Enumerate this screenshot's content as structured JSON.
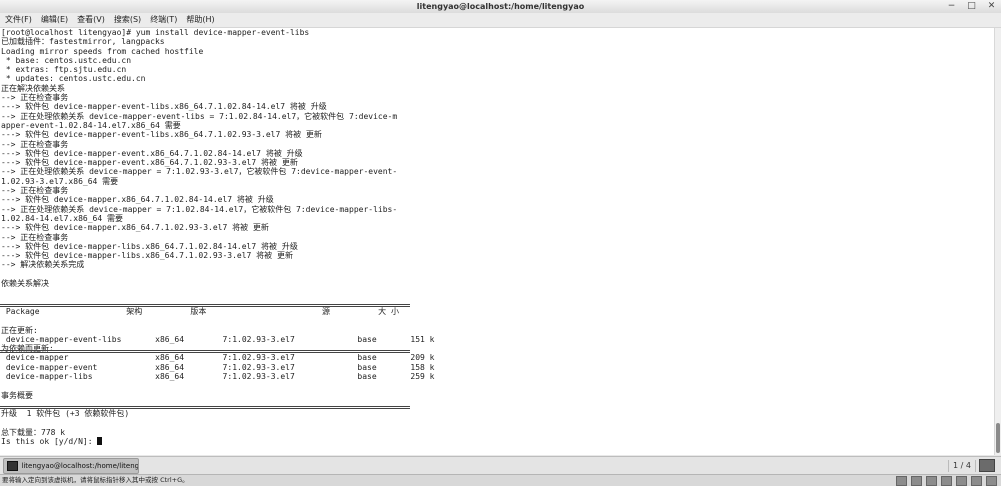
{
  "window": {
    "title": "litengyao@localhost:/home/litengyao"
  },
  "window_controls": {
    "minimize": "−",
    "maximize": "□",
    "close": "✕"
  },
  "menu": [
    "文件(F)",
    "编辑(E)",
    "查看(V)",
    "搜索(S)",
    "终端(T)",
    "帮助(H)"
  ],
  "terminal": {
    "lines": [
      "[root@localhost litengyao]# yum install device-mapper-event-libs",
      "已加载插件：fastestmirror, langpacks",
      "Loading mirror speeds from cached hostfile",
      " * base: centos.ustc.edu.cn",
      " * extras: ftp.sjtu.edu.cn",
      " * updates: centos.ustc.edu.cn",
      "正在解决依赖关系",
      "--> 正在检查事务",
      "---> 软件包 device-mapper-event-libs.x86_64.7.1.02.84-14.el7 将被 升级",
      "--> 正在处理依赖关系 device-mapper-event-libs = 7:1.02.84-14.el7，它被软件包 7:device-m",
      "apper-event-1.02.84-14.el7.x86_64 需要",
      "---> 软件包 device-mapper-event-libs.x86_64.7.1.02.93-3.el7 将被 更新",
      "--> 正在检查事务",
      "---> 软件包 device-mapper-event.x86_64.7.1.02.84-14.el7 将被 升级",
      "---> 软件包 device-mapper-event.x86_64.7.1.02.93-3.el7 将被 更新",
      "--> 正在处理依赖关系 device-mapper = 7:1.02.93-3.el7，它被软件包 7:device-mapper-event-",
      "1.02.93-3.el7.x86_64 需要",
      "--> 正在检查事务",
      "---> 软件包 device-mapper.x86_64.7.1.02.84-14.el7 将被 升级",
      "--> 正在处理依赖关系 device-mapper = 7:1.02.84-14.el7，它被软件包 7:device-mapper-libs-",
      "1.02.84-14.el7.x86_64 需要",
      "---> 软件包 device-mapper.x86_64.7.1.02.93-3.el7 将被 更新",
      "--> 正在检查事务",
      "---> 软件包 device-mapper-libs.x86_64.7.1.02.84-14.el7 将被 升级",
      "---> 软件包 device-mapper-libs.x86_64.7.1.02.93-3.el7 将被 更新",
      "--> 解决依赖关系完成",
      "",
      "依赖关系解决",
      "",
      "",
      " Package                  架构          版本                        源          大 小",
      "",
      "正在更新:",
      " device-mapper-event-libs       x86_64        7:1.02.93-3.el7             base       151 k",
      "为依赖而更新:",
      " device-mapper                  x86_64        7:1.02.93-3.el7             base       209 k",
      " device-mapper-event            x86_64        7:1.02.93-3.el7             base       158 k",
      " device-mapper-libs             x86_64        7:1.02.93-3.el7             base       259 k",
      "",
      "事务概要",
      "",
      "升级  1 软件包 (+3 依赖软件包)",
      "",
      "总下载量：778 k",
      "Is this ok [y/d/N]: "
    ]
  },
  "taskbar": {
    "item_label": "litengyao@localhost:/home/liteng...",
    "pager": "1 / 4"
  },
  "statusbar": {
    "hint": "要将输入定向到该虚拟机，请将鼠标指针移入其中或按 Ctrl+G。"
  }
}
